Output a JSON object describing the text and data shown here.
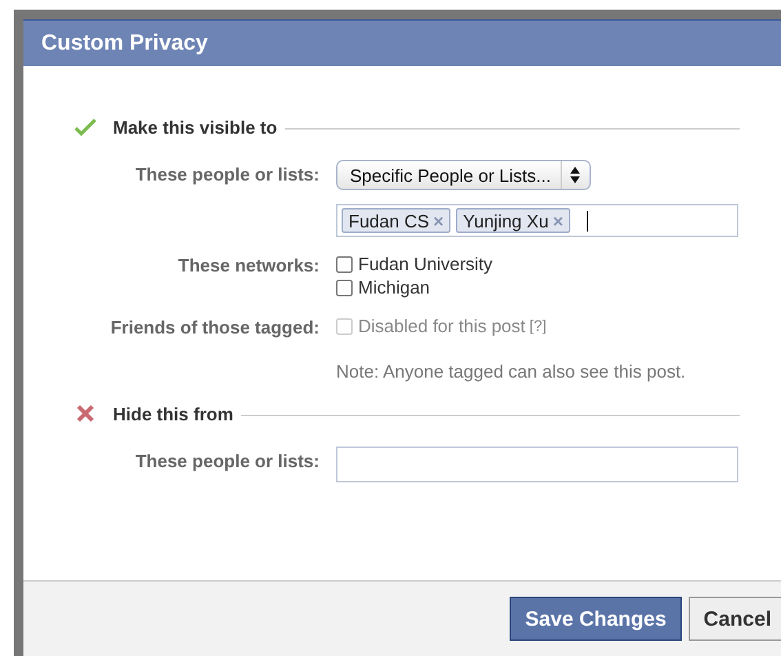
{
  "window": {
    "title": "Custom Privacy"
  },
  "sections": [
    {
      "kind": "allow",
      "heading": "Make this visible to",
      "rows": [
        {
          "kind": "select",
          "label": "These people or lists:",
          "value": "Specific People or Lists..."
        },
        {
          "kind": "tokens",
          "tokens": [
            {
              "text": "Fudan CS",
              "remove": "×"
            },
            {
              "text": "Yunjing Xu",
              "remove": "×"
            }
          ]
        },
        {
          "kind": "checkboxes",
          "label": "These networks:",
          "options": [
            {
              "label": "Fudan University",
              "checked": false,
              "disabled": false
            },
            {
              "label": "Michigan",
              "checked": false,
              "disabled": false
            }
          ]
        },
        {
          "kind": "checkboxes",
          "label": "Friends of those tagged:",
          "options": [
            {
              "label": "Disabled for this post",
              "help": "[?]",
              "checked": false,
              "disabled": true
            }
          ]
        },
        {
          "kind": "note",
          "text": "Note: Anyone tagged can also see this post."
        }
      ]
    },
    {
      "kind": "deny",
      "heading": "Hide this from",
      "rows": [
        {
          "kind": "input",
          "label": "These people or lists:"
        }
      ]
    }
  ],
  "buttons": [
    {
      "label": "Save Changes",
      "kind": "primary"
    },
    {
      "label": "Cancel",
      "kind": "secondary"
    }
  ]
}
